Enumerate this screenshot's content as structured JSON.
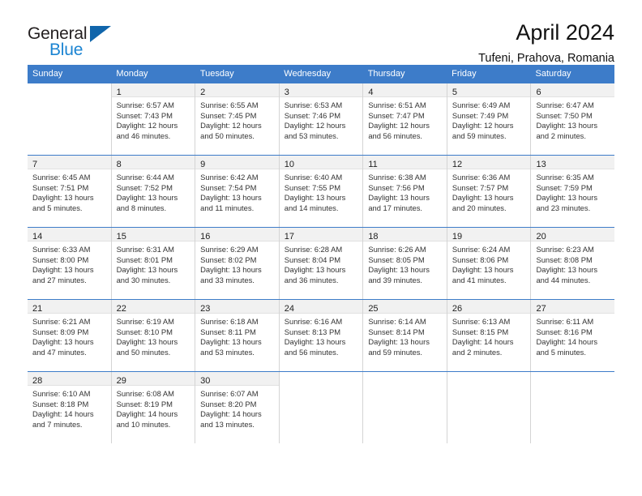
{
  "brand": {
    "name_part1": "General",
    "name_part2": "Blue",
    "accent_color": "#1b84d2",
    "triangle_color": "#1065ab"
  },
  "header": {
    "title": "April 2024",
    "subtitle": "Tufeni, Prahova, Romania"
  },
  "theme": {
    "header_row_color": "#3d7cc9",
    "daynum_band_color": "#f1f1f1",
    "cell_border_color": "#d4d4d4"
  },
  "calendar": {
    "weekdays": [
      "Sunday",
      "Monday",
      "Tuesday",
      "Wednesday",
      "Thursday",
      "Friday",
      "Saturday"
    ],
    "weeks": [
      [
        {
          "day": "",
          "lines": []
        },
        {
          "day": "1",
          "lines": [
            "Sunrise: 6:57 AM",
            "Sunset: 7:43 PM",
            "Daylight: 12 hours",
            "and 46 minutes."
          ]
        },
        {
          "day": "2",
          "lines": [
            "Sunrise: 6:55 AM",
            "Sunset: 7:45 PM",
            "Daylight: 12 hours",
            "and 50 minutes."
          ]
        },
        {
          "day": "3",
          "lines": [
            "Sunrise: 6:53 AM",
            "Sunset: 7:46 PM",
            "Daylight: 12 hours",
            "and 53 minutes."
          ]
        },
        {
          "day": "4",
          "lines": [
            "Sunrise: 6:51 AM",
            "Sunset: 7:47 PM",
            "Daylight: 12 hours",
            "and 56 minutes."
          ]
        },
        {
          "day": "5",
          "lines": [
            "Sunrise: 6:49 AM",
            "Sunset: 7:49 PM",
            "Daylight: 12 hours",
            "and 59 minutes."
          ]
        },
        {
          "day": "6",
          "lines": [
            "Sunrise: 6:47 AM",
            "Sunset: 7:50 PM",
            "Daylight: 13 hours",
            "and 2 minutes."
          ]
        }
      ],
      [
        {
          "day": "7",
          "lines": [
            "Sunrise: 6:45 AM",
            "Sunset: 7:51 PM",
            "Daylight: 13 hours",
            "and 5 minutes."
          ]
        },
        {
          "day": "8",
          "lines": [
            "Sunrise: 6:44 AM",
            "Sunset: 7:52 PM",
            "Daylight: 13 hours",
            "and 8 minutes."
          ]
        },
        {
          "day": "9",
          "lines": [
            "Sunrise: 6:42 AM",
            "Sunset: 7:54 PM",
            "Daylight: 13 hours",
            "and 11 minutes."
          ]
        },
        {
          "day": "10",
          "lines": [
            "Sunrise: 6:40 AM",
            "Sunset: 7:55 PM",
            "Daylight: 13 hours",
            "and 14 minutes."
          ]
        },
        {
          "day": "11",
          "lines": [
            "Sunrise: 6:38 AM",
            "Sunset: 7:56 PM",
            "Daylight: 13 hours",
            "and 17 minutes."
          ]
        },
        {
          "day": "12",
          "lines": [
            "Sunrise: 6:36 AM",
            "Sunset: 7:57 PM",
            "Daylight: 13 hours",
            "and 20 minutes."
          ]
        },
        {
          "day": "13",
          "lines": [
            "Sunrise: 6:35 AM",
            "Sunset: 7:59 PM",
            "Daylight: 13 hours",
            "and 23 minutes."
          ]
        }
      ],
      [
        {
          "day": "14",
          "lines": [
            "Sunrise: 6:33 AM",
            "Sunset: 8:00 PM",
            "Daylight: 13 hours",
            "and 27 minutes."
          ]
        },
        {
          "day": "15",
          "lines": [
            "Sunrise: 6:31 AM",
            "Sunset: 8:01 PM",
            "Daylight: 13 hours",
            "and 30 minutes."
          ]
        },
        {
          "day": "16",
          "lines": [
            "Sunrise: 6:29 AM",
            "Sunset: 8:02 PM",
            "Daylight: 13 hours",
            "and 33 minutes."
          ]
        },
        {
          "day": "17",
          "lines": [
            "Sunrise: 6:28 AM",
            "Sunset: 8:04 PM",
            "Daylight: 13 hours",
            "and 36 minutes."
          ]
        },
        {
          "day": "18",
          "lines": [
            "Sunrise: 6:26 AM",
            "Sunset: 8:05 PM",
            "Daylight: 13 hours",
            "and 39 minutes."
          ]
        },
        {
          "day": "19",
          "lines": [
            "Sunrise: 6:24 AM",
            "Sunset: 8:06 PM",
            "Daylight: 13 hours",
            "and 41 minutes."
          ]
        },
        {
          "day": "20",
          "lines": [
            "Sunrise: 6:23 AM",
            "Sunset: 8:08 PM",
            "Daylight: 13 hours",
            "and 44 minutes."
          ]
        }
      ],
      [
        {
          "day": "21",
          "lines": [
            "Sunrise: 6:21 AM",
            "Sunset: 8:09 PM",
            "Daylight: 13 hours",
            "and 47 minutes."
          ]
        },
        {
          "day": "22",
          "lines": [
            "Sunrise: 6:19 AM",
            "Sunset: 8:10 PM",
            "Daylight: 13 hours",
            "and 50 minutes."
          ]
        },
        {
          "day": "23",
          "lines": [
            "Sunrise: 6:18 AM",
            "Sunset: 8:11 PM",
            "Daylight: 13 hours",
            "and 53 minutes."
          ]
        },
        {
          "day": "24",
          "lines": [
            "Sunrise: 6:16 AM",
            "Sunset: 8:13 PM",
            "Daylight: 13 hours",
            "and 56 minutes."
          ]
        },
        {
          "day": "25",
          "lines": [
            "Sunrise: 6:14 AM",
            "Sunset: 8:14 PM",
            "Daylight: 13 hours",
            "and 59 minutes."
          ]
        },
        {
          "day": "26",
          "lines": [
            "Sunrise: 6:13 AM",
            "Sunset: 8:15 PM",
            "Daylight: 14 hours",
            "and 2 minutes."
          ]
        },
        {
          "day": "27",
          "lines": [
            "Sunrise: 6:11 AM",
            "Sunset: 8:16 PM",
            "Daylight: 14 hours",
            "and 5 minutes."
          ]
        }
      ],
      [
        {
          "day": "28",
          "lines": [
            "Sunrise: 6:10 AM",
            "Sunset: 8:18 PM",
            "Daylight: 14 hours",
            "and 7 minutes."
          ]
        },
        {
          "day": "29",
          "lines": [
            "Sunrise: 6:08 AM",
            "Sunset: 8:19 PM",
            "Daylight: 14 hours",
            "and 10 minutes."
          ]
        },
        {
          "day": "30",
          "lines": [
            "Sunrise: 6:07 AM",
            "Sunset: 8:20 PM",
            "Daylight: 14 hours",
            "and 13 minutes."
          ]
        },
        {
          "day": "",
          "lines": []
        },
        {
          "day": "",
          "lines": []
        },
        {
          "day": "",
          "lines": []
        },
        {
          "day": "",
          "lines": []
        }
      ]
    ]
  }
}
